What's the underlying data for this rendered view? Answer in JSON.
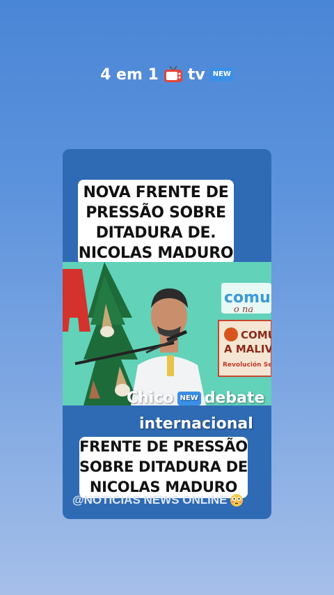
{
  "header": {
    "title_text": "4 em 1",
    "tv_label": "tv",
    "new_badge": "NEW",
    "icons": [
      "television-icon",
      "new-badge-icon"
    ]
  },
  "card": {
    "headline_top_lines": [
      "NOVA FRENTE DE",
      "PRESSÃO SOBRE",
      "DITADURA DE.",
      "NICOLAS MADURO"
    ],
    "photo_signs": {
      "sign_top": "comu",
      "sign_top_sub": "o na",
      "sign_board_line1": "COMU",
      "sign_board_line2": "A MALIV",
      "sign_board_line3": "Revolución Se"
    },
    "overlay_line1_a": "Chico",
    "overlay_badge": "NEW",
    "overlay_line1_b": "debate",
    "overlay_line2": "internacional",
    "headline_bottom_lines": [
      "FRENTE DE PRESSÃO",
      "SOBRE DITADURA DE",
      "NICOLAS MADURO"
    ],
    "handle": "@NOTICIAS NEWS ONLINE"
  },
  "colors": {
    "card_bg": "#2f6bb4",
    "badge_blue": "#3b8fe6",
    "tv_red": "#e0453a"
  }
}
